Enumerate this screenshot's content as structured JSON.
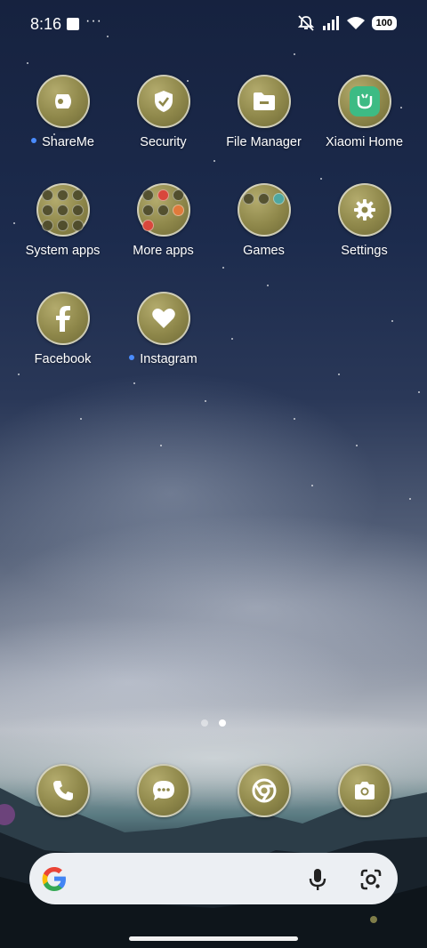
{
  "status_bar": {
    "time": "8:16",
    "more": "···",
    "battery": "100",
    "icons": [
      "notification-square-icon",
      "mute-icon",
      "signal-icon",
      "wifi-icon",
      "battery-icon"
    ]
  },
  "apps": [
    {
      "label": "ShareMe",
      "icon": "shareme-icon",
      "new_dot": true
    },
    {
      "label": "Security",
      "icon": "shield-check-icon",
      "new_dot": false
    },
    {
      "label": "File Manager",
      "icon": "folder-icon",
      "new_dot": false
    },
    {
      "label": "Xiaomi Home",
      "icon": "mi-home-icon",
      "new_dot": false
    },
    {
      "label": "System apps",
      "icon": "folder-system-apps-icon",
      "new_dot": false
    },
    {
      "label": "More apps",
      "icon": "folder-more-apps-icon",
      "new_dot": false
    },
    {
      "label": "Games",
      "icon": "folder-games-icon",
      "new_dot": false
    },
    {
      "label": "Settings",
      "icon": "gear-icon",
      "new_dot": false
    },
    {
      "label": "Facebook",
      "icon": "facebook-icon",
      "new_dot": false
    },
    {
      "label": "Instagram",
      "icon": "heart-icon",
      "new_dot": true
    }
  ],
  "pager": {
    "pages": 2,
    "current": 2
  },
  "dock": [
    {
      "icon": "phone-icon"
    },
    {
      "icon": "messages-icon"
    },
    {
      "icon": "chrome-icon"
    },
    {
      "icon": "camera-icon"
    }
  ],
  "search_bar": {
    "logo": "google-g-icon",
    "mic": "microphone-icon",
    "lens": "google-lens-icon"
  },
  "colors": {
    "icon_fill": "#8e874a",
    "new_dot": "#4a8cff",
    "search_bg": "#eceff3"
  }
}
